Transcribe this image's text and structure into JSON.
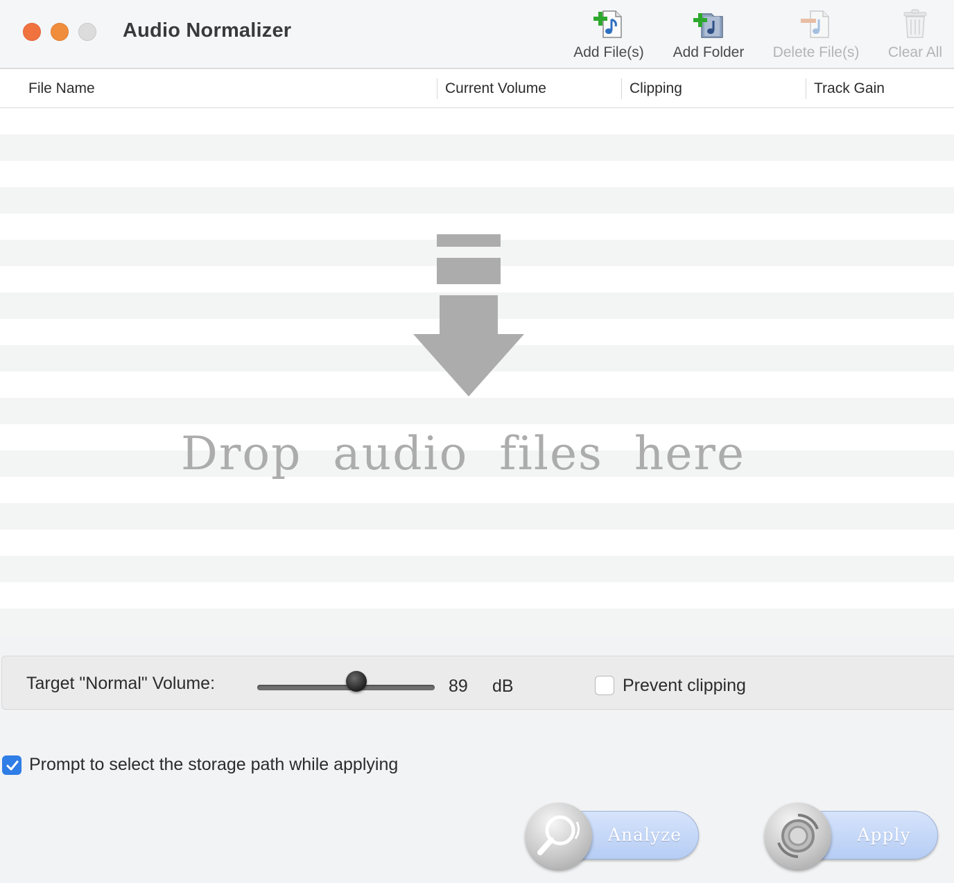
{
  "window": {
    "title": "Audio Normalizer"
  },
  "toolbar": {
    "add_files": "Add File(s)",
    "add_folder": "Add Folder",
    "delete_files": "Delete File(s)",
    "clear_all": "Clear All"
  },
  "table": {
    "columns": [
      "File Name",
      "Current Volume",
      "Clipping",
      "Track Gain"
    ],
    "rows": []
  },
  "dropzone": {
    "text": "Drop audio files here"
  },
  "volume": {
    "label": "Target \"Normal\" Volume:",
    "value": "89",
    "unit": "dB",
    "slider_fraction": 0.56,
    "prevent_clipping_label": "Prevent clipping",
    "prevent_clipping_checked": false
  },
  "options": {
    "prompt_label": "Prompt to select the storage path while applying",
    "prompt_checked": true
  },
  "actions": {
    "analyze": "Analyze",
    "apply": "Apply"
  },
  "colors": {
    "accent": "#2f7de6",
    "close": "#f0733f",
    "minimize": "#f08d3c",
    "zoom": "#dcdcdc",
    "action_pill": "#c4d7f7",
    "drop_hint": "#acacac"
  }
}
